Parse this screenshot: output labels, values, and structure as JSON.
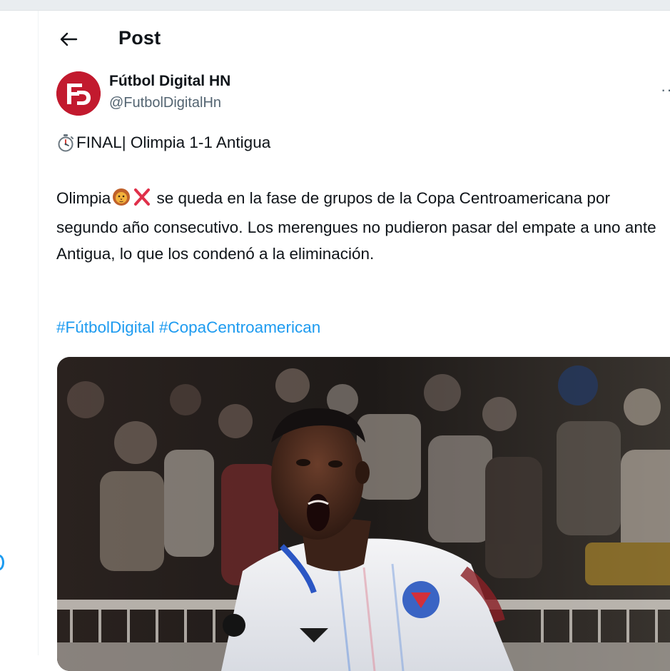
{
  "header": {
    "title": "Post"
  },
  "author": {
    "name": "Fútbol Digital HN",
    "handle": "@FutbolDigitalHn"
  },
  "post": {
    "line1": "FINAL| Olimpia 1-1 Antigua",
    "body_start": "Olimpia",
    "body_rest": " se queda en la fase de grupos de la Copa Centroamericana por segundo año consecutivo. Los merengues no pudieron pasar del empate a uno ante Antigua, lo que los condenó a la eliminación.",
    "hashtags": [
      "#FútbolDigital",
      "#CopaCentroamerican"
    ]
  },
  "icons": {
    "back": "arrow-left-icon",
    "more": "more-icon",
    "timer": "stopwatch-icon",
    "lion": "lion-emoji-icon",
    "cross": "cross-mark-icon"
  },
  "colors": {
    "accent": "#1d9bf0",
    "avatar_bg": "#c21a2e",
    "secondary_text": "#536471"
  }
}
